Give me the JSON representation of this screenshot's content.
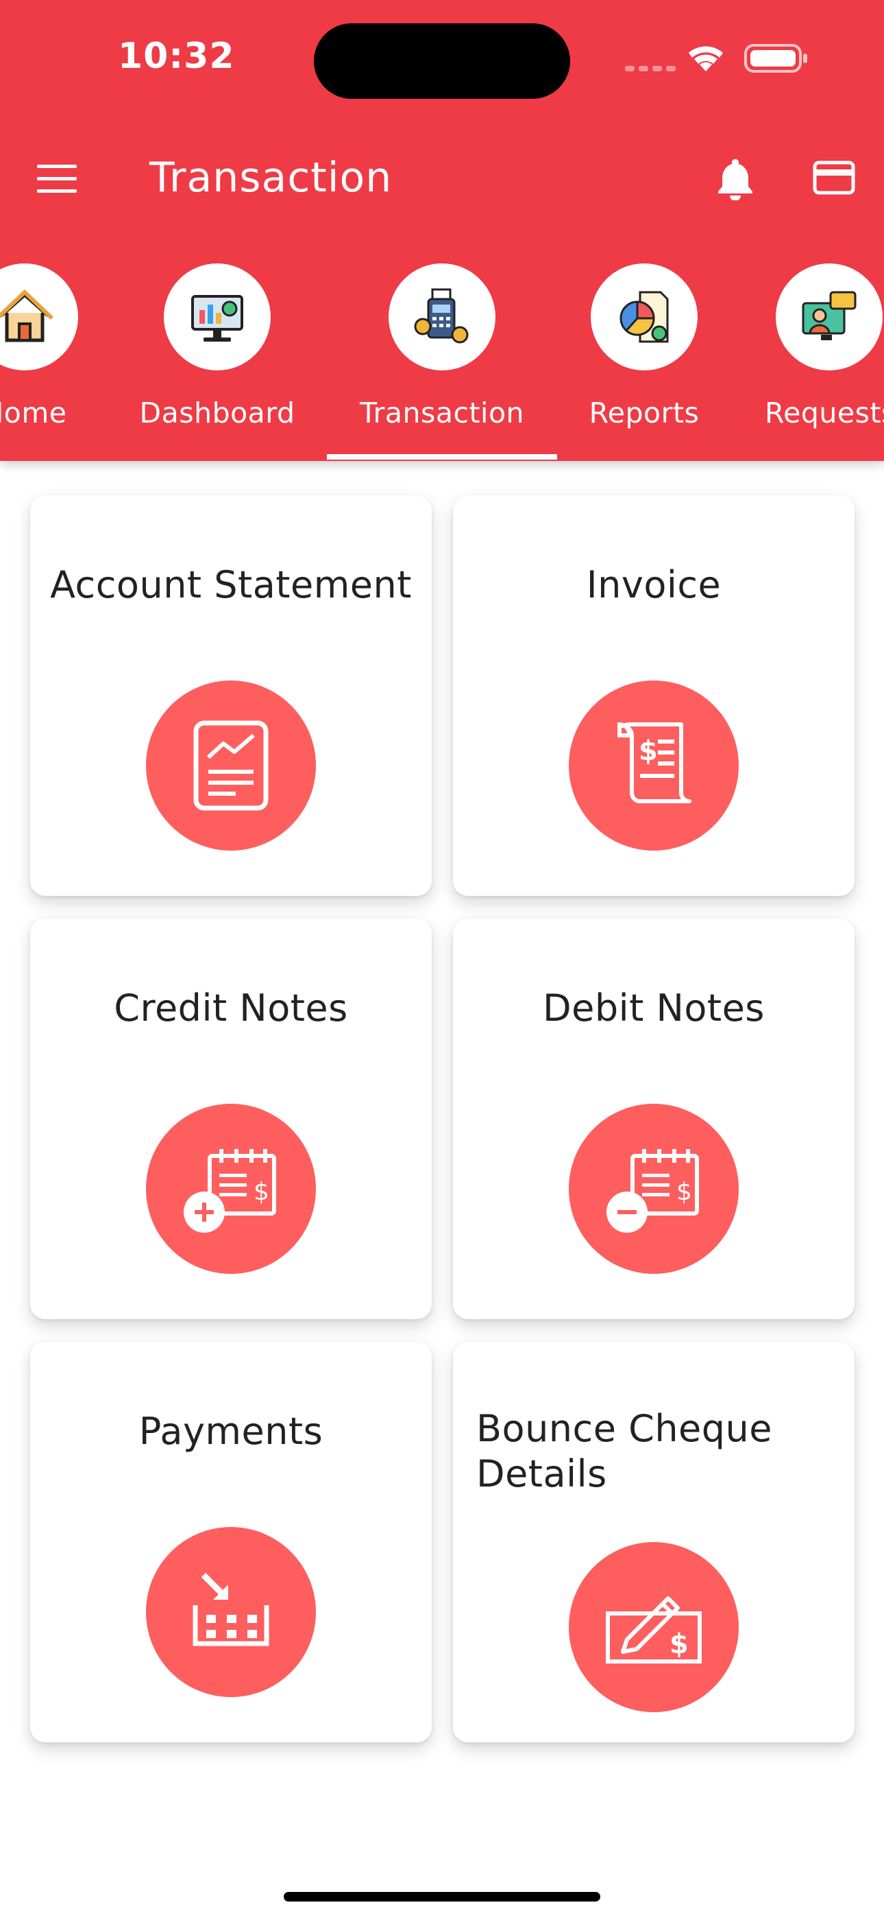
{
  "status_bar": {
    "time": "10:32"
  },
  "app_bar": {
    "title": "Transaction",
    "menu_icon": "hamburger-menu-icon",
    "notification_icon": "bell-icon",
    "card_icon": "credit-card-icon"
  },
  "tabs": [
    {
      "label": "Home",
      "icon": "house-icon"
    },
    {
      "label": "Dashboard",
      "icon": "dashboard-monitor-icon"
    },
    {
      "label": "Transaction",
      "icon": "payment-terminal-icon",
      "active": true
    },
    {
      "label": "Reports",
      "icon": "pie-chart-report-icon"
    },
    {
      "label": "Requests",
      "icon": "support-request-icon"
    }
  ],
  "cards": [
    {
      "title": "Account Statement",
      "icon": "statement-chart-icon"
    },
    {
      "title": "Invoice",
      "icon": "invoice-scroll-icon"
    },
    {
      "title": "Credit Notes",
      "icon": "credit-note-icon"
    },
    {
      "title": "Debit Notes",
      "icon": "debit-note-icon"
    },
    {
      "title": "Payments",
      "icon": "payment-receive-icon"
    },
    {
      "title": "Bounce Cheque Details",
      "icon": "cheque-icon"
    }
  ],
  "colors": {
    "primary": "#ee3b46",
    "accent": "#fe5e5e",
    "card_text": "#222222"
  }
}
